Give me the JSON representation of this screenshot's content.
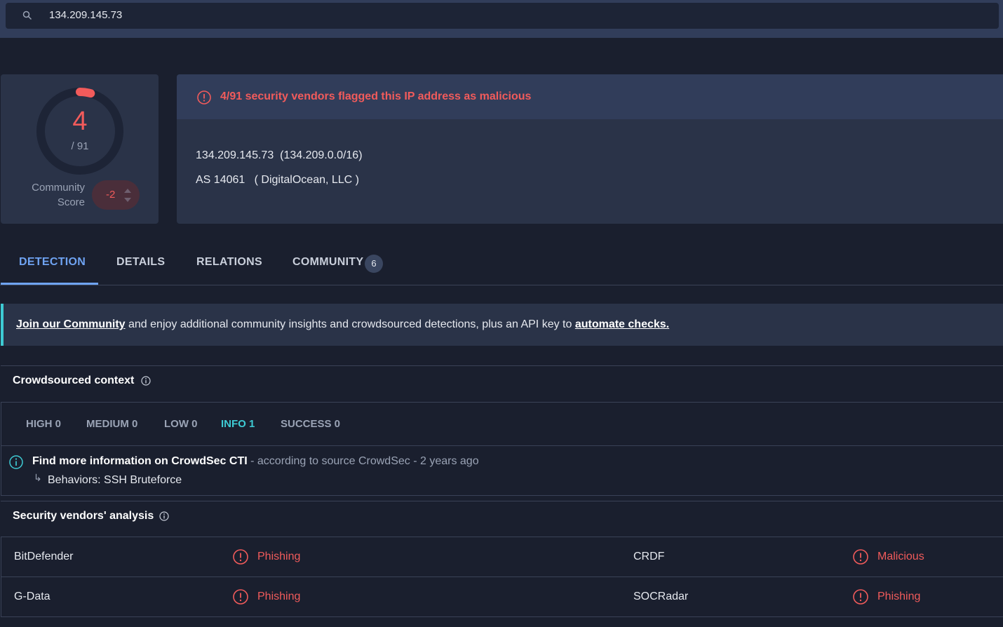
{
  "search": {
    "query": "134.209.145.73"
  },
  "score": {
    "detections": "4",
    "total": "/ 91",
    "detection_fraction": 0.044,
    "community_label_line1": "Community",
    "community_label_line2": "Score",
    "community_value": "-2"
  },
  "summary": {
    "alert": "4/91 security vendors flagged this IP address as malicious",
    "ip_line": "134.209.145.73  (134.209.0.0/16)",
    "as_line": "AS 14061   ( DigitalOcean, LLC )"
  },
  "tabs": [
    {
      "label": "DETECTION"
    },
    {
      "label": "DETAILS"
    },
    {
      "label": "RELATIONS"
    },
    {
      "label": "COMMUNITY",
      "badge": "6"
    }
  ],
  "banner": {
    "link1": "Join our Community",
    "middle": " and enjoy additional community insights and crowdsourced detections, plus an API key to ",
    "link2": "automate checks."
  },
  "crowdsourced": {
    "title": "Crowdsourced context",
    "severities": [
      {
        "label": "HIGH 0"
      },
      {
        "label": "MEDIUM 0"
      },
      {
        "label": "LOW 0"
      },
      {
        "label": "INFO 1"
      },
      {
        "label": "SUCCESS 0"
      }
    ],
    "entry_title": "Find more information on CrowdSec CTI",
    "entry_source": " - according to source CrowdSec - 2 years ago",
    "entry_arrow": "↳",
    "entry_behaviors": "Behaviors: SSH Bruteforce"
  },
  "vendors": {
    "title": "Security vendors' analysis",
    "rows": [
      {
        "left_name": "BitDefender",
        "left_result": "Phishing",
        "right_name": "CRDF",
        "right_result": "Malicious"
      },
      {
        "left_name": "G-Data",
        "left_result": "Phishing",
        "right_name": "SOCRadar",
        "right_result": "Phishing"
      }
    ]
  },
  "colors": {
    "accent": "#6fa3f2",
    "malicious": "#f15b5b",
    "info": "#3ecbd4"
  }
}
